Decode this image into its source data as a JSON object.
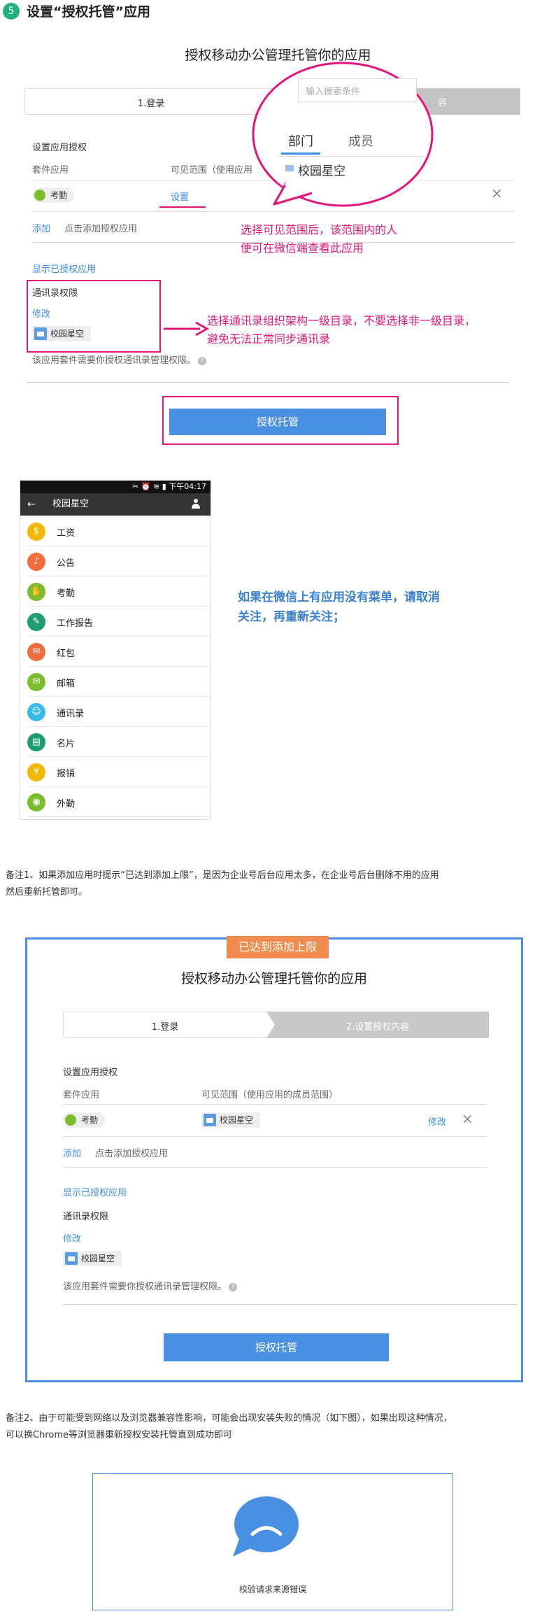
{
  "step": {
    "number": "5",
    "title": "设置“授权托管”应用"
  },
  "panel1": {
    "title": "授权移动办公管理托管你的应用",
    "step1": "1.登录",
    "step2_partial": "容",
    "search_placeholder": "输入搜索条件",
    "tab_dept": "部门",
    "tab_member": "成员",
    "dept_item": "校园星空",
    "section_label": "设置应用授权",
    "col_app": "套件应用",
    "col_scope": "可见范围（使用应用",
    "app_tag": "考勤",
    "set_link": "设置",
    "close": "×",
    "add_link": "添加",
    "add_hint": "点击添加授权应用",
    "show_authorized": "显示已授权应用",
    "contacts_perm": "通讯录权限",
    "modify": "修改",
    "folder_tag": "校园星空",
    "perm_note": "该应用套件需要你授权通讯录管理权限。",
    "help": "?",
    "button": "授权托管"
  },
  "annotations": {
    "scope_note_1": "选择可见范围后，该范围内的人",
    "scope_note_2": "便可在微信端查看此应用",
    "contacts_note_1": "选择通讯录组织架构一级目录，不要选择非一级目录，",
    "contacts_note_2": "避免无法正常同步通讯录",
    "wechat_note_1": "如果在微信上有应用没有菜单，请取消",
    "wechat_note_2": "关注，再重新关注；"
  },
  "phone": {
    "status": "下午04:17",
    "title": "校园星空",
    "back": "←",
    "apps": [
      {
        "label": "工资",
        "icon": "salary-icon",
        "color": "#f5b800",
        "glyph": "$"
      },
      {
        "label": "公告",
        "icon": "bell-icon",
        "color": "#f26b3a",
        "glyph": "♪"
      },
      {
        "label": "考勤",
        "icon": "hand-icon",
        "color": "#7bbd2c",
        "glyph": "✋"
      },
      {
        "label": "工作报告",
        "icon": "report-icon",
        "color": "#1e9e6e",
        "glyph": "✎"
      },
      {
        "label": "红包",
        "icon": "red-envelope-icon",
        "color": "#f26b3a",
        "glyph": "✉"
      },
      {
        "label": "邮箱",
        "icon": "mail-icon",
        "color": "#7bbd2c",
        "glyph": "✉"
      },
      {
        "label": "通讯录",
        "icon": "contacts-icon",
        "color": "#3ab8e6",
        "glyph": "☺"
      },
      {
        "label": "名片",
        "icon": "card-icon",
        "color": "#1e9e6e",
        "glyph": "▤"
      },
      {
        "label": "报销",
        "icon": "reimburse-icon",
        "color": "#f5b800",
        "glyph": "¥"
      },
      {
        "label": "外勤",
        "icon": "location-icon",
        "color": "#7bbd2c",
        "glyph": "◉"
      }
    ]
  },
  "note1": {
    "line1": "备注1、如果添加应用时提示“已达到添加上限”，是因为企业号后台应用太多，在企业号后台删除不用的应用",
    "line2": "然后重新托管即可。"
  },
  "panel2": {
    "limit_badge": "已达到添加上限",
    "title": "授权移动办公管理托管你的应用",
    "step1": "1.登录",
    "step2": "2.设置授权内容",
    "section_label": "设置应用授权",
    "col_app": "套件应用",
    "col_scope": "可见范围（使用应用的成员范围）",
    "app_tag": "考勤",
    "scope_tag": "校园星空",
    "modify_link": "修改",
    "close": "×",
    "add_link": "添加",
    "add_hint": "点击添加授权应用",
    "show_authorized": "显示已授权应用",
    "contacts_perm": "通讯录权限",
    "modify": "修改",
    "folder_tag": "校园星空",
    "perm_note": "该应用套件需要你授权通讯录管理权限。",
    "help": "?",
    "button": "授权托管"
  },
  "note2": {
    "line1": "备注2、由于可能受到网络以及浏览器兼容性影响，可能会出现安装失败的情况（如下图），如果出现这种情况，",
    "line2": "可以换Chrome等浏览器重新授权安装托管直到成功即可"
  },
  "error_box": {
    "message": "校验请求来源错误"
  }
}
